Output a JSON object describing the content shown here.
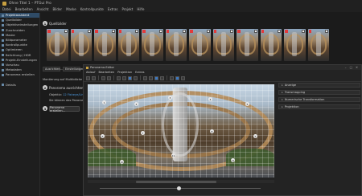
{
  "window": {
    "title": "Ohne Titel 1 – PTGui Pro"
  },
  "menu": [
    "Datei",
    "Bearbeiten",
    "Ansicht",
    "Bilder",
    "Maske",
    "Kontrollpunkte",
    "Extras",
    "Projekt",
    "Hilfe"
  ],
  "sidebar": {
    "items": [
      {
        "label": "Projektassistent",
        "active": true
      },
      {
        "label": "Quellbilder"
      },
      {
        "label": "Objektiveinstellungen"
      },
      {
        "label": "Zuschneiden"
      },
      {
        "label": "Maske"
      },
      {
        "label": "Bildparameter"
      },
      {
        "label": "Kontrollpunkte"
      },
      {
        "label": "Optimieren"
      },
      {
        "label": "Belichtung / HDR"
      },
      {
        "label": "Projekt-Einstellungen"
      },
      {
        "label": "Vorschau"
      },
      {
        "label": "Metadaten"
      },
      {
        "label": "Panorama erstellen"
      }
    ],
    "exit_label": "Details"
  },
  "steps": {
    "step1": {
      "number": "1",
      "title": "Quellbilder"
    },
    "step2": {
      "number": "2",
      "title": "Panorama ausrichten"
    },
    "step3": {
      "number": "3"
    }
  },
  "left_panel": {
    "select_left": "Ausrichten…",
    "select_right": "Einstellungen",
    "info_text": "Montierung auf Multiblöcke",
    "objektiv_prefix": "Objektiv:",
    "objektiv_link": "12 Fisheye/Linse",
    "hint_text": "Sie können das Panorama",
    "create_button": "Panorama erstellen…"
  },
  "thumbnails": {
    "count": 12
  },
  "editor": {
    "title": "Panorama-Editor",
    "menu": [
      "Ablauf",
      "Bearbeiten",
      "Projektion",
      "Extras"
    ],
    "sections": [
      "Anzeige",
      "Transmapping",
      "Numerische Transformation",
      "Projektion"
    ],
    "badges": [
      "1",
      "2",
      "3",
      "4",
      "5",
      "6",
      "7",
      "8",
      "9",
      "10",
      "11",
      "12"
    ]
  },
  "colors": {
    "accent": "#3b78c2",
    "active_sidebar": "#2f4b66",
    "link": "#4d9be0",
    "brand": "#c8a040"
  }
}
